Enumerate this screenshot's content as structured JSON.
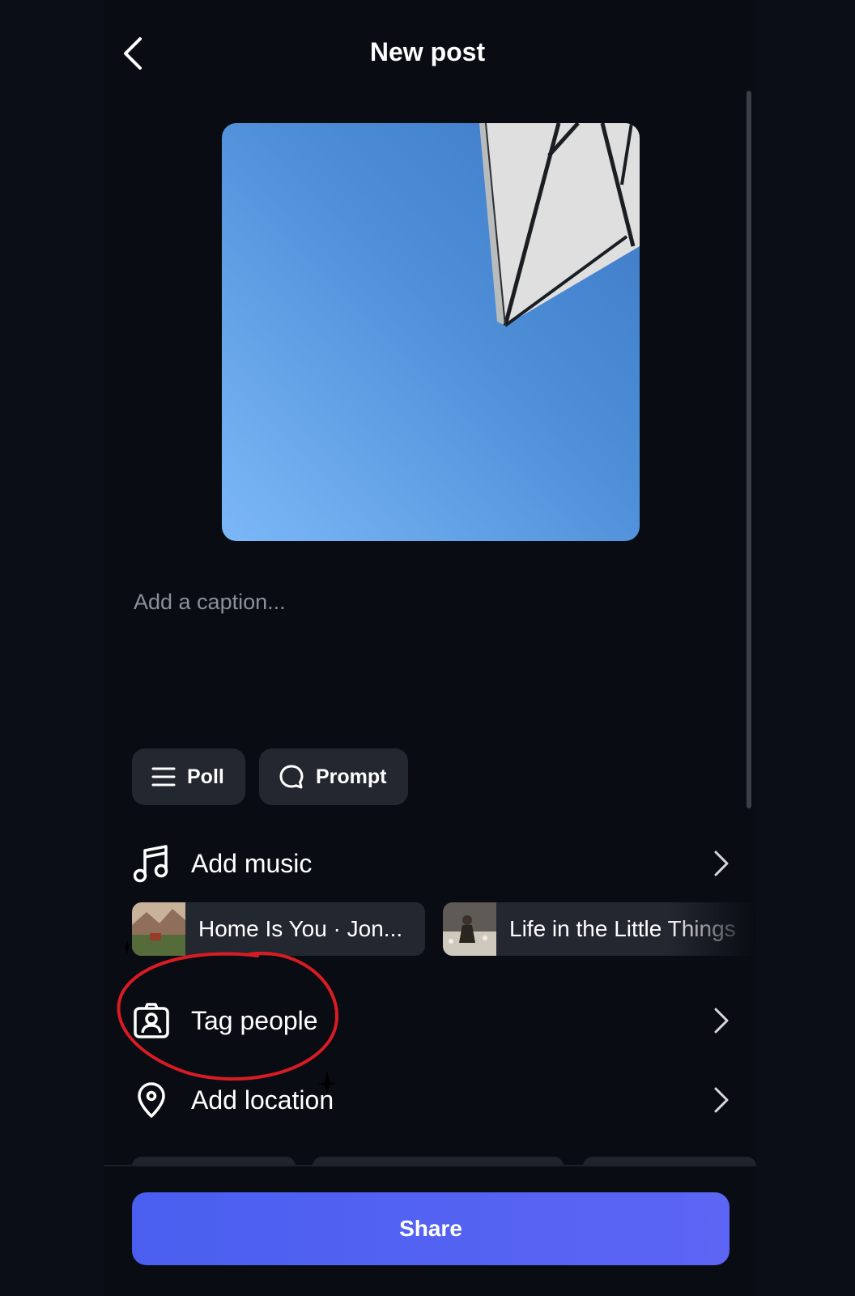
{
  "header": {
    "title": "New post",
    "back_icon": "chevron-left-icon"
  },
  "caption": {
    "placeholder": "Add a caption..."
  },
  "chips": {
    "poll_label": "Poll",
    "poll_icon": "list-icon",
    "prompt_label": "Prompt",
    "prompt_icon": "speech-bubble-icon"
  },
  "rows": {
    "music_label": "Add music",
    "music_icon": "music-note-icon",
    "tag_label": "Tag people",
    "tag_icon": "tag-person-icon",
    "location_label": "Add location",
    "location_icon": "location-pin-icon"
  },
  "music_suggestions": [
    {
      "title": "Home Is You · Jon..."
    },
    {
      "title": "Life in the Little Things"
    }
  ],
  "share": {
    "label": "Share"
  },
  "colors": {
    "accent": "#4f5ff2",
    "background": "#0a0e16",
    "chip": "#23272f",
    "annotation": "#d91b24"
  }
}
